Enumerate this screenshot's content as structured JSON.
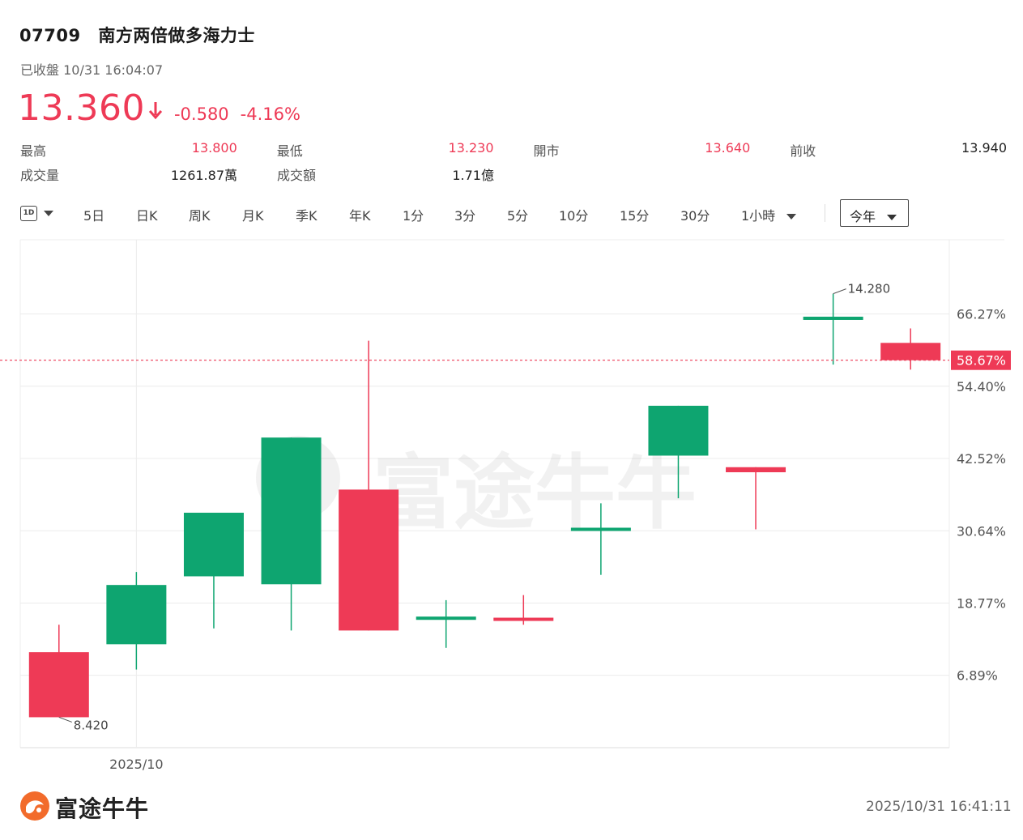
{
  "header": {
    "code": "07709",
    "name": "南方两倍做多海力士",
    "status": "已收盤 10/31 16:04:07"
  },
  "quote": {
    "price": "13.360",
    "change": "-0.580",
    "change_pct": "-4.16%",
    "direction_icon": "down-arrow-icon"
  },
  "stats": [
    {
      "label": "最高",
      "value": "13.800",
      "color": "red"
    },
    {
      "label": "最低",
      "value": "13.230",
      "color": "red"
    },
    {
      "label": "開市",
      "value": "13.640",
      "color": "red"
    },
    {
      "label": "前收",
      "value": "13.940",
      "color": "neutral"
    },
    {
      "label": "成交量",
      "value": "1261.87萬",
      "color": "neutral"
    },
    {
      "label": "成交額",
      "value": "1.71億",
      "color": "neutral"
    }
  ],
  "toolbar": {
    "period_items": [
      "5日",
      "日K",
      "周K",
      "月K",
      "季K",
      "年K",
      "1分",
      "3分",
      "5分",
      "10分",
      "15分",
      "30分",
      "1小時"
    ],
    "range_selected": "今年",
    "day_icon_label": "1D"
  },
  "colors": {
    "up": "#0ea570",
    "down": "#ee3a56",
    "grid": "#ececec",
    "axis_text": "#555555"
  },
  "chart_data": {
    "type": "candlestick",
    "xlabel": "",
    "ylabel": "",
    "x_tick_labels": [
      "2025/10"
    ],
    "y_axis_unit": "percent",
    "y_tick_labels": [
      "66.27%",
      "54.40%",
      "42.52%",
      "30.64%",
      "18.77%",
      "6.89%"
    ],
    "ylim_pct": [
      -5.0,
      78.2
    ],
    "base_price": 8.42,
    "current_marker": {
      "label": "58.67%",
      "price": 13.36
    },
    "high_annotation": "14.280",
    "low_annotation": "8.420",
    "candles": [
      {
        "open": 9.32,
        "high": 9.7,
        "low": 8.42,
        "close": 8.42,
        "dir": "down"
      },
      {
        "open": 9.43,
        "high": 10.43,
        "low": 9.08,
        "close": 10.25,
        "dir": "up"
      },
      {
        "open": 11.25,
        "high": 11.25,
        "low": 9.65,
        "close": 10.37,
        "dir": "up"
      },
      {
        "open": 12.29,
        "high": 12.29,
        "low": 9.62,
        "close": 10.26,
        "dir": "up"
      },
      {
        "open": 9.62,
        "high": 13.63,
        "low": 9.62,
        "close": 11.57,
        "dir": "down"
      },
      {
        "open": 9.79,
        "high": 10.04,
        "low": 9.38,
        "close": 9.79,
        "dir": "up"
      },
      {
        "open": 9.79,
        "high": 10.11,
        "low": 9.7,
        "close": 9.76,
        "dir": "down"
      },
      {
        "open": 11.02,
        "high": 11.38,
        "low": 10.39,
        "close": 11.02,
        "dir": "up"
      },
      {
        "open": 12.73,
        "high": 12.73,
        "low": 11.45,
        "close": 12.04,
        "dir": "up"
      },
      {
        "open": 11.88,
        "high": 11.88,
        "low": 11.02,
        "close": 11.81,
        "dir": "down"
      },
      {
        "open": 13.94,
        "high": 14.28,
        "low": 13.3,
        "close": 13.94,
        "dir": "up"
      },
      {
        "open": 13.6,
        "high": 13.8,
        "low": 13.23,
        "close": 13.36,
        "dir": "down"
      }
    ]
  },
  "watermark": "富途牛牛",
  "footer": {
    "brand": "富途牛牛",
    "timestamp": "2025/10/31 16:41:11"
  }
}
